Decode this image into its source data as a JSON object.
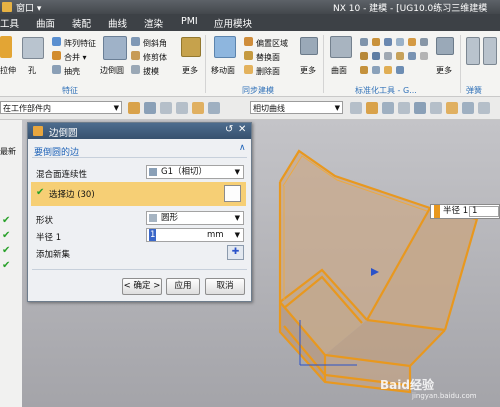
{
  "window": {
    "title_left": "窗口 ▾",
    "title_right": "NX 10 - 建模 - [UG10.0练习三维建模"
  },
  "menu": [
    "工具",
    "曲面",
    "装配",
    "曲线",
    "渲染",
    "PMI",
    "应用模块"
  ],
  "ribbon": {
    "buttons": {
      "hole_partial": "拉伸",
      "hole": "孔",
      "pattern_feature": "阵列特征",
      "unite": "合并 ▾",
      "shell": "抽壳",
      "edge_blend": "边倒圆",
      "chamfer": "倒斜角",
      "trim_body": "修剪体",
      "draft": "拔模",
      "more1": "更多",
      "move_face": "移动面",
      "offset_region": "偏置区域",
      "replace_face": "替换面",
      "delete_face": "删除面",
      "more2": "更多",
      "surface": "曲面",
      "more3": "更多"
    },
    "groups": {
      "feature": "特征",
      "sync_modeling": "同步建模",
      "standard_tools": "标准化工具 - G...",
      "spring": "弹簧"
    }
  },
  "toolbar": {
    "scope_combo": "在工作部件内",
    "curve_rule_combo": "相切曲线"
  },
  "left_panel": {
    "label": "最新"
  },
  "dialog": {
    "title": "边倒圆",
    "section_title": "要倒圆的边",
    "blend_continuity_label": "混合面连续性",
    "blend_continuity_value": "G1（相切）",
    "select_edge_label": "选择边 (30)",
    "shape_label": "形状",
    "shape_value": "圆形",
    "radius_label": "半径 1",
    "radius_value": "1",
    "radius_unit": "mm",
    "add_new_set_label": "添加新集",
    "ok_button": "< 确定 >",
    "apply_button": "应用",
    "cancel_button": "取消"
  },
  "viewport": {
    "radius_callout_label": "半径 1",
    "radius_callout_value": "1",
    "watermark": "Baid经验",
    "watermark_url": "jingyan.baidu.com"
  },
  "colors": {
    "titlebar": "#4b5057",
    "menubar": "#3d4146",
    "ribbon_group_label": "#3373b9",
    "dialog_title": "#3f5b7b",
    "section_title": "#1f63b8",
    "select_highlight": "#f6cf75",
    "model_edge": "#e8981f",
    "model_face": "#c9a98a"
  }
}
